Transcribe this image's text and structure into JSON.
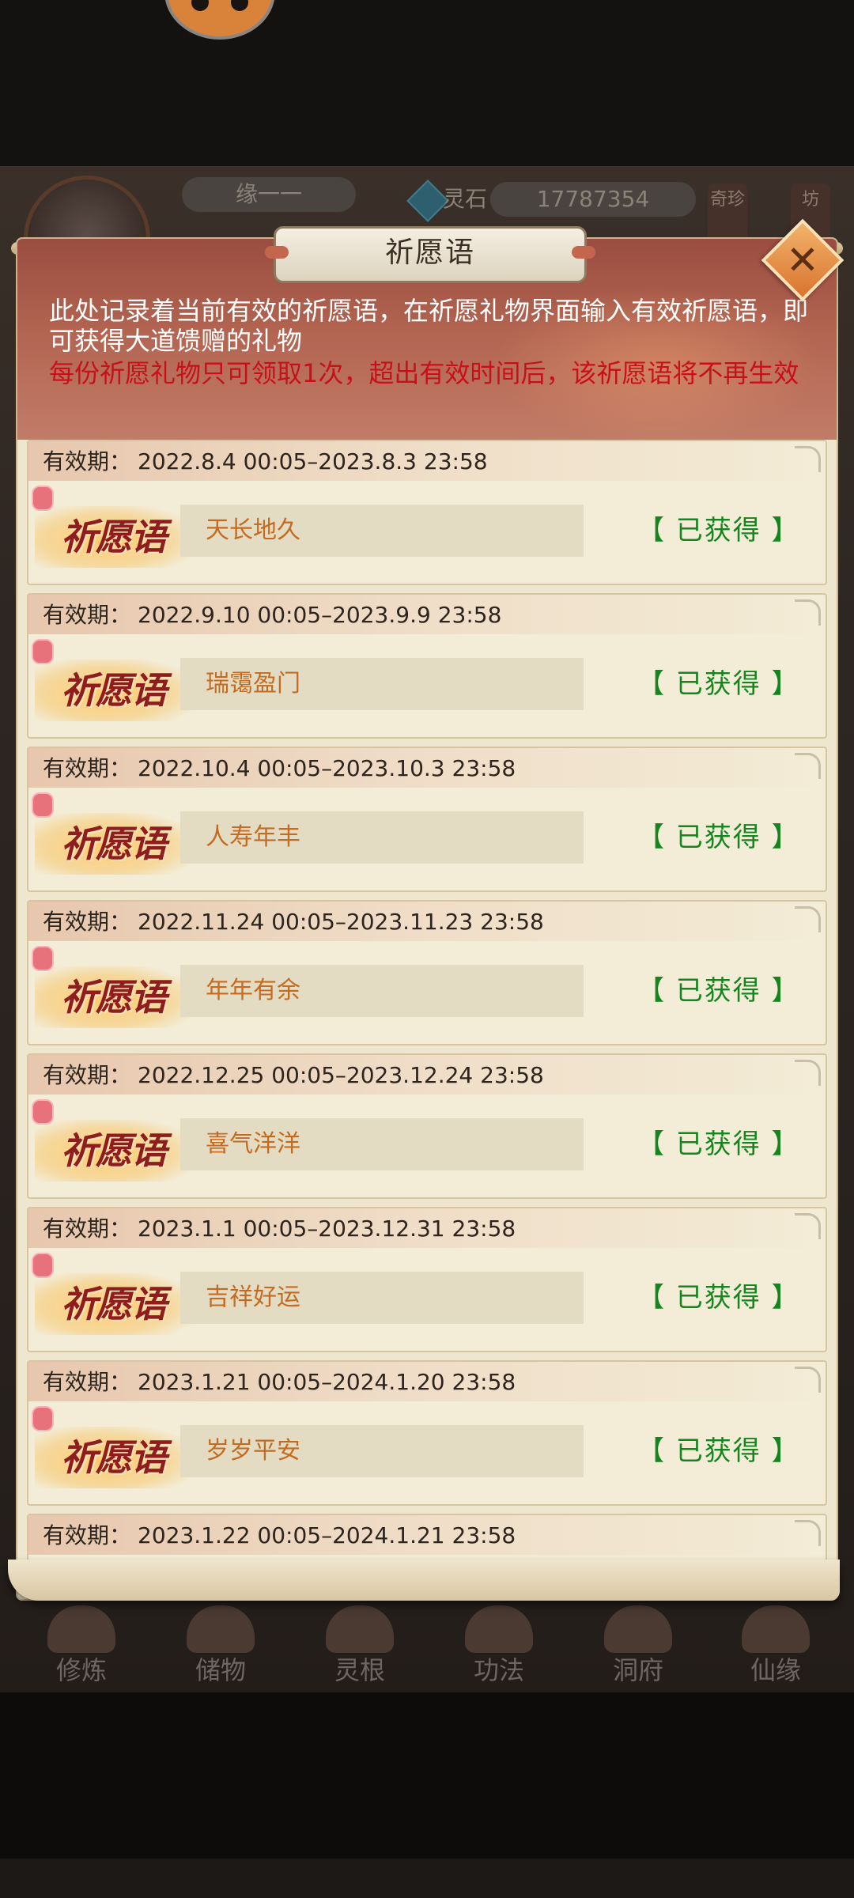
{
  "hud": {
    "name_field": "缘一一",
    "currency_name": "灵石",
    "currency_value": "17787354",
    "side_left": "奇珍",
    "side_right": "坊"
  },
  "nav": [
    {
      "label": "修炼",
      "icon": "cultivate-icon"
    },
    {
      "label": "储物",
      "icon": "storage-bag-icon"
    },
    {
      "label": "灵根",
      "icon": "spirit-root-icon"
    },
    {
      "label": "功法",
      "icon": "scroll-icon"
    },
    {
      "label": "洞府",
      "icon": "cave-house-icon"
    },
    {
      "label": "仙缘",
      "icon": "immortal-fate-icon"
    }
  ],
  "dialog": {
    "title": "祈愿语",
    "close_label": "✕",
    "description": "此处记录着当前有效的祈愿语，在祈愿礼物界面输入有效祈愿语，即可获得大道馈赠的礼物",
    "warning": "每份祈愿礼物只可领取1次，超出有效时间后，该祈愿语将不再生效",
    "badge_text": "祈愿语",
    "period_label": "有效期：",
    "entries": [
      {
        "period": "2022.8.4 00:05–2023.8.3 23:58",
        "phrase": "天长地久",
        "status": "【 已获得 】"
      },
      {
        "period": "2022.9.10 00:05–2023.9.9 23:58",
        "phrase": "瑞霭盈门",
        "status": "【 已获得 】"
      },
      {
        "period": "2022.10.4 00:05–2023.10.3 23:58",
        "phrase": "人寿年丰",
        "status": "【 已获得 】"
      },
      {
        "period": "2022.11.24 00:05–2023.11.23 23:58",
        "phrase": "年年有余",
        "status": "【 已获得 】"
      },
      {
        "period": "2022.12.25 00:05–2023.12.24 23:58",
        "phrase": "喜气洋洋",
        "status": "【 已获得 】"
      },
      {
        "period": "2023.1.1 00:05–2023.12.31 23:58",
        "phrase": "吉祥好运",
        "status": "【 已获得 】"
      },
      {
        "period": "2023.1.21 00:05–2024.1.20 23:58",
        "phrase": "岁岁平安",
        "status": "【 已获得 】"
      },
      {
        "period": "2023.1.22 00:05–2024.1.21 23:58",
        "phrase": "",
        "status": ""
      }
    ]
  }
}
